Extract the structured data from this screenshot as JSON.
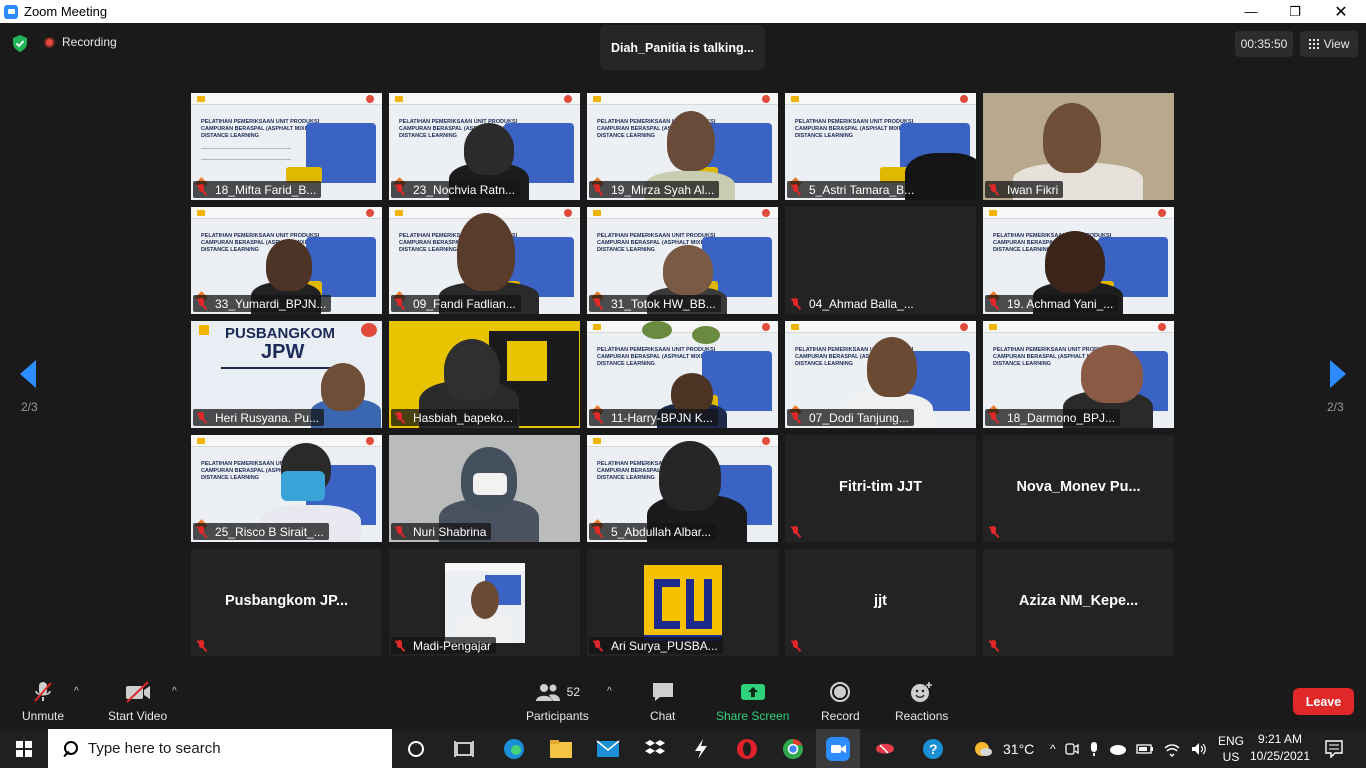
{
  "window": {
    "title": "Zoom Meeting"
  },
  "header": {
    "recording_label": "Recording",
    "talking_banner": "Diah_Panitia is talking...",
    "timer": "00:35:50",
    "view_label": "View"
  },
  "pager": {
    "left": "2/3",
    "right": "2/3"
  },
  "slide_text": "PELATIHAN PEMERIKSAAN UNIT PRODUKSI CAMPURAN BERASPAL (ASPHALT MIXING PLANT) DISTANCE LEARNING",
  "jpw_slide": {
    "title": "PUSBANGKOM",
    "subtitle": "JPW"
  },
  "tiles": [
    "18_Mifta Farid_B...",
    "23_Nochvia Ratn...",
    "19_Mirza Syah Al...",
    "5_Astri Tamara_B...",
    "Iwan Fikri",
    "33_Yumardi_BPJN...",
    "09_Fandi Fadlian...",
    "31_Totok HW_BB...",
    "04_Ahmad Balla_...",
    "19. Achmad Yani_...",
    "Heri Rusyana. Pu...",
    "Hasbiah_bapeko...",
    "11-Harry-BPJN K...",
    "07_Dodi Tanjung...",
    "18_Darmono_BPJ...",
    "25_Risco B Sirait_...",
    "Nuri Shabrina",
    "5_Abdullah Albar...",
    "",
    "",
    "",
    "Madi-Pengajar",
    "Ari Surya_PUSBA...",
    "",
    ""
  ],
  "name_tiles": {
    "fitri": "Fitri-tim JJT",
    "nova": "Nova_Monev  Pu...",
    "pusbangkom": "Pusbangkom  JP...",
    "jjt": "jjt",
    "aziza": "Aziza  NM_Kepe..."
  },
  "toolbar": {
    "unmute": "Unmute",
    "start_video": "Start Video",
    "participants": "Participants",
    "participants_count": "52",
    "chat": "Chat",
    "share_screen": "Share Screen",
    "record": "Record",
    "reactions": "Reactions",
    "leave": "Leave"
  },
  "taskbar": {
    "search_placeholder": "Type here to search",
    "temperature": "31°C",
    "lang_top": "ENG",
    "lang_bottom": "US",
    "time": "9:21 AM",
    "date": "10/25/2021"
  },
  "colors": {
    "zoom_blue": "#2d8cff",
    "leave_red": "#e02828",
    "share_green": "#2fd27a",
    "muted_red": "#e02828"
  }
}
